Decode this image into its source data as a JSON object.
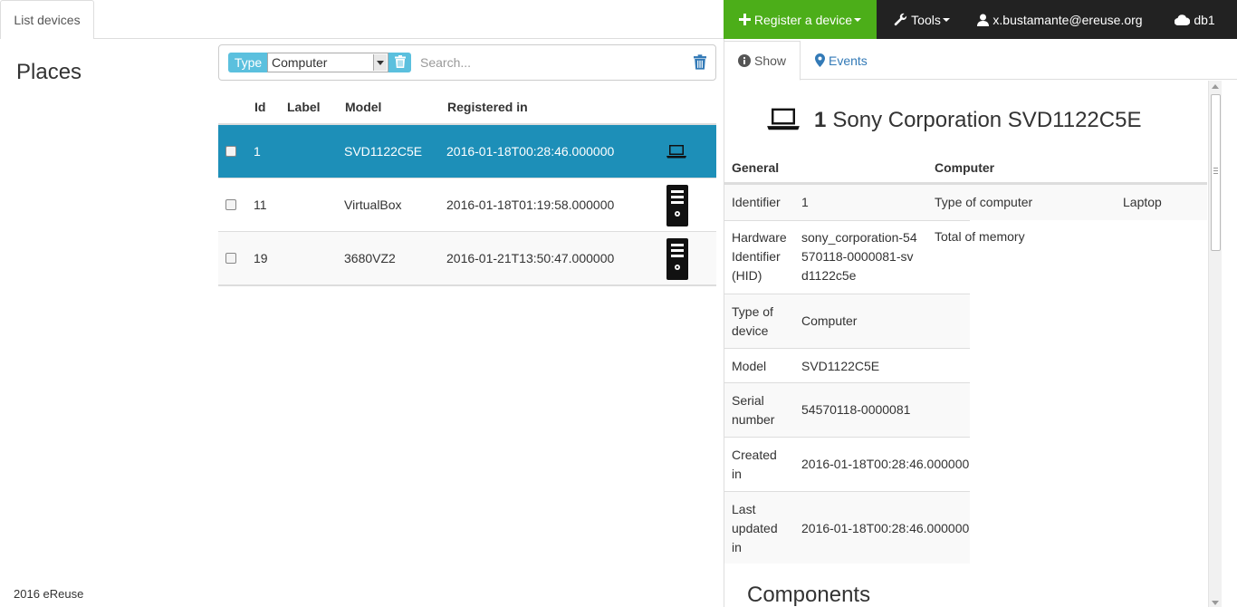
{
  "topbar": {
    "tab_label": "List devices",
    "register_label": "Register a device",
    "tools_label": "Tools",
    "user_label": "x.bustamante@ereuse.org",
    "db_label": "db1"
  },
  "sidebar": {
    "title": "Places",
    "footer": "2016 eReuse"
  },
  "filter": {
    "type_label": "Type",
    "type_value": "Computer",
    "search_placeholder": "Search..."
  },
  "devices": {
    "headers": {
      "id": "Id",
      "label": "Label",
      "model": "Model",
      "registered": "Registered in"
    },
    "rows": [
      {
        "id": "1",
        "label": "",
        "model": "SVD1122C5E",
        "registered": "2016-01-18T00:28:46.000000",
        "icon": "laptop-icon",
        "selected": true
      },
      {
        "id": "11",
        "label": "",
        "model": "VirtualBox",
        "registered": "2016-01-18T01:19:58.000000",
        "icon": "desktop-tower-icon",
        "selected": false
      },
      {
        "id": "19",
        "label": "",
        "model": "3680VZ2",
        "registered": "2016-01-21T13:50:47.000000",
        "icon": "desktop-tower-icon",
        "selected": false
      }
    ]
  },
  "detail": {
    "tabs": {
      "show": "Show",
      "events": "Events"
    },
    "id": "1",
    "name": "Sony Corporation SVD1122C5E",
    "general_header": "General",
    "computer_header": "Computer",
    "general": [
      {
        "key": "Identifier",
        "value": "1"
      },
      {
        "key": "Hardware Identifier (HID)",
        "value": "sony_corporation-54570118-0000081-svd1122c5e"
      },
      {
        "key": "Type of device",
        "value": "Computer"
      },
      {
        "key": "Model",
        "value": "SVD1122C5E"
      },
      {
        "key": "Serial number",
        "value": "54570118-0000081"
      },
      {
        "key": "Created in",
        "value": "2016-01-18T00:28:46.000000"
      },
      {
        "key": "Last updated in",
        "value": "2016-01-18T00:28:46.000000"
      }
    ],
    "computer": [
      {
        "key": "Type of computer",
        "value": "Laptop"
      },
      {
        "key": "Total of memory",
        "value": ""
      }
    ],
    "components_title": "Components"
  },
  "colors": {
    "register_bg": "#4cae19",
    "navbar_bg": "#222222",
    "selected_row": "#1d8fb8",
    "type_label_bg": "#5bc0de",
    "link": "#337ab7"
  }
}
